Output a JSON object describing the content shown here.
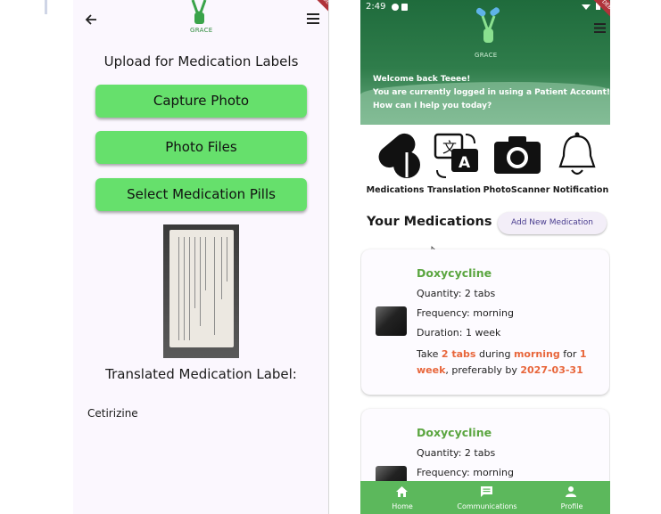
{
  "left_screen": {
    "logo_text": "GRACE",
    "ribbon_text": "DEBUG",
    "title": "Upload for Medication Labels",
    "buttons": [
      "Capture Photo",
      "Photo Files",
      "Select Medication Pills"
    ],
    "translated_heading": "Translated Medication Label:",
    "translated_text": "Cetirizine"
  },
  "right_screen": {
    "status_time": "2:49",
    "logo_text": "GRACE",
    "ribbon_text": "DEBUG",
    "welcome": [
      "Welcome back Teeee!",
      "You are currently logged in using a Patient Account!",
      "How can I help you today?"
    ],
    "features": [
      {
        "label": "Medications",
        "icon": "pills-icon"
      },
      {
        "label": "Translation",
        "icon": "translate-icon"
      },
      {
        "label": "PhotoScanner",
        "icon": "camera-icon"
      },
      {
        "label": "Notification",
        "icon": "bell-icon"
      }
    ],
    "section_title": "Your Medications",
    "add_button": "Add New Medication",
    "medications": [
      {
        "name": "Doxycycline",
        "quantity": "Quantity: 2 tabs",
        "frequency": "Frequency: morning",
        "duration": "Duration: 1 week",
        "instr_take": "Take ",
        "instr_dose": "2 tabs",
        "instr_during": " during ",
        "instr_time": "morning",
        "instr_for": " for ",
        "instr_len1": "1",
        "instr_len2": "week",
        "instr_pref": ", preferably by ",
        "instr_date": "2027-03-31"
      },
      {
        "name": "Doxycycline",
        "quantity": "Quantity: 2 tabs",
        "frequency": "Frequency: morning"
      }
    ],
    "nav": [
      {
        "label": "Home",
        "icon": "home-icon"
      },
      {
        "label": "Communications",
        "icon": "message-icon"
      },
      {
        "label": "Profile",
        "icon": "person-icon"
      }
    ]
  },
  "colors": {
    "button_green": "#66e06c",
    "hero_green": "#2f7d4b",
    "med_name_green": "#5aa53f",
    "highlight_orange": "#e8663b",
    "nav_green": "#5cb85c"
  }
}
